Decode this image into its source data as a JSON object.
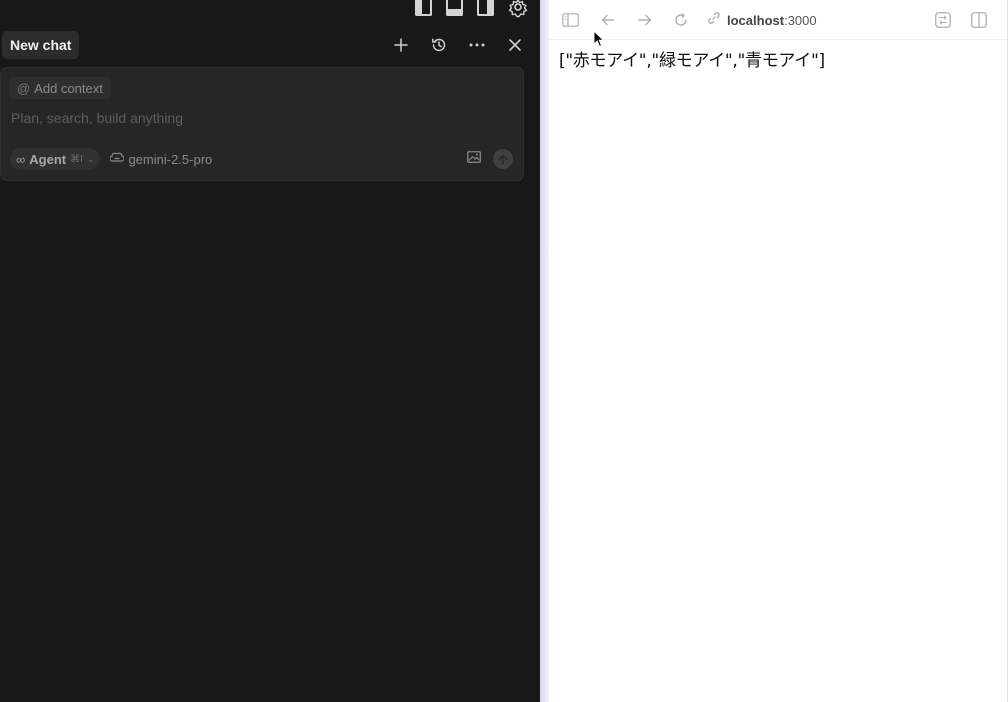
{
  "chat": {
    "tab_title": "New chat",
    "context_chip": "Add context",
    "context_symbol": "@",
    "prompt_placeholder": "Plan, search, build anything",
    "mode": {
      "label": "Agent",
      "shortcut": "⌘I",
      "symbol": "∞",
      "chevron": "⌄"
    },
    "model": "gemini-2.5-pro"
  },
  "icons": {
    "layout_left": "layout-sidebar-left-icon",
    "layout_bottom": "layout-panel-bottom-icon",
    "layout_right": "layout-sidebar-right-icon",
    "settings": "gear-icon",
    "new_chat": "plus-icon",
    "history": "history-icon",
    "more": "more-horizontal-icon",
    "close": "close-icon",
    "image": "image-icon",
    "send": "arrow-up-icon"
  },
  "browser": {
    "url_host": "localhost",
    "url_port": ":3000",
    "content": "[\"赤モアイ\",\"緑モアイ\",\"青モアイ\"]"
  },
  "colors": {
    "panel_bg": "#181818",
    "composer_bg": "#262626",
    "browser_bg": "#ffffff"
  }
}
